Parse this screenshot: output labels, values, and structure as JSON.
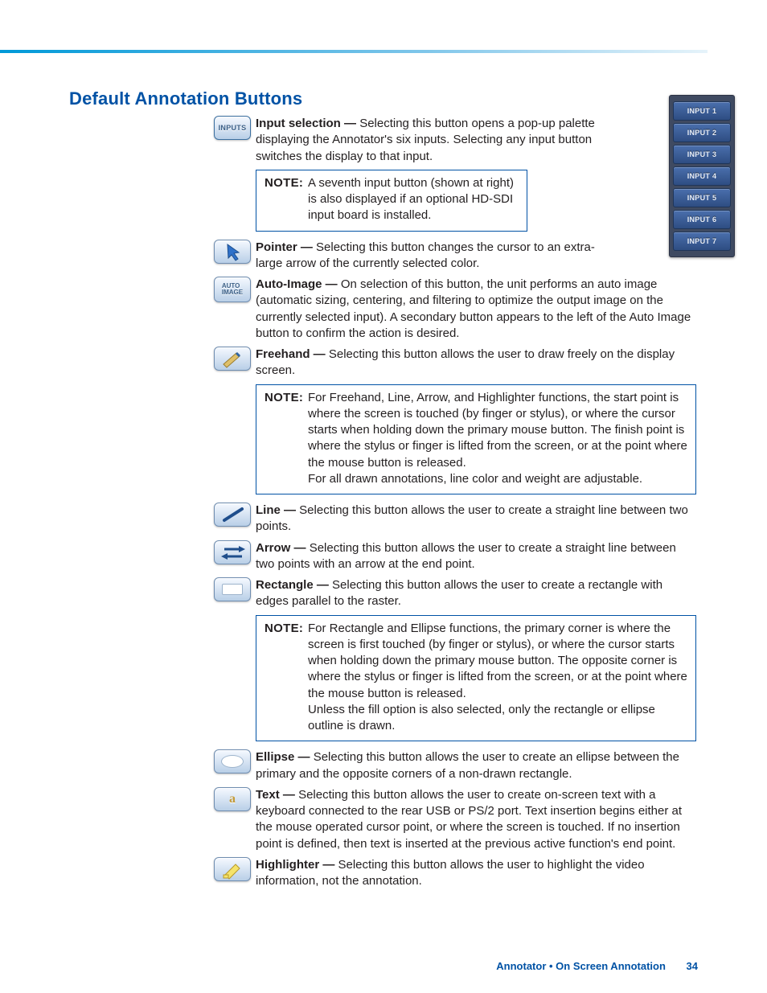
{
  "heading": "Default Annotation Buttons",
  "items": {
    "inputSelection": {
      "term": "Input selection — ",
      "desc": "Selecting this button opens a pop-up palette displaying the Annotator's six inputs. Selecting any input button switches the display to that input.",
      "iconLabel": "INPUTS"
    },
    "pointer": {
      "term": "Pointer — ",
      "desc": "Selecting this button changes the cursor to an extra-large arrow of the currently selected color."
    },
    "autoImage": {
      "term": "Auto-Image — ",
      "desc": "On selection of this button, the unit performs an auto image (automatic sizing, centering, and filtering to optimize the output image on the currently selected input). A secondary button appears to the left of the Auto Image button to confirm the action is desired.",
      "iconLabel": "AUTO\nIMAGE"
    },
    "freehand": {
      "term": "Freehand — ",
      "desc": "Selecting this button allows the user to draw freely on the display screen."
    },
    "line": {
      "term": "Line — ",
      "desc": "Selecting this button allows the user to create a straight line between two points."
    },
    "arrow": {
      "term": "Arrow — ",
      "desc": "Selecting this button allows the user to create a straight line between two points with an arrow at the end point."
    },
    "rectangle": {
      "term": "Rectangle — ",
      "desc": "Selecting this button allows the user to create a rectangle with edges parallel to the raster."
    },
    "ellipse": {
      "term": "Ellipse — ",
      "desc": "Selecting this button allows the user to create an ellipse between the primary and the opposite corners of a non-drawn rectangle."
    },
    "text": {
      "term": "Text — ",
      "desc": "Selecting this button allows the user to create on-screen text with a keyboard connected to the rear USB or PS/2 port. Text insertion begins either at the mouse operated cursor point, or where the screen is touched. If no insertion point is defined, then text is inserted at the previous active function's end point.",
      "iconLabel": "a"
    },
    "highlighter": {
      "term": "Highlighter — ",
      "desc": "Selecting this button allows the user to highlight the video information, not the annotation."
    }
  },
  "notes": {
    "label": "NOTE:",
    "n1": "A seventh input button (shown at right) is also displayed if an optional HD-SDI input board is installed.",
    "n2a": "For Freehand, Line, Arrow, and Highlighter functions, the start point is where the screen is touched (by finger or stylus), or where the cursor starts when holding down the primary mouse button. The finish point is where the stylus or finger is lifted from the screen, or at the point where the mouse button is released.",
    "n2b": "For all drawn annotations, line color and weight are adjustable.",
    "n3a": "For Rectangle and Ellipse functions, the primary corner is where the screen is first touched (by finger or stylus), or where the cursor starts when holding down the primary mouse button. The opposite corner is where the stylus or finger is lifted from the screen, or at the point where the mouse button is released.",
    "n3b": "Unless the fill option is also selected, only the rectangle or ellipse outline is drawn."
  },
  "inputPalette": [
    "INPUT 1",
    "INPUT 2",
    "INPUT 3",
    "INPUT 4",
    "INPUT 5",
    "INPUT 6",
    "INPUT 7"
  ],
  "footer": {
    "section": "Annotator • On Screen Annotation",
    "page": "34"
  }
}
